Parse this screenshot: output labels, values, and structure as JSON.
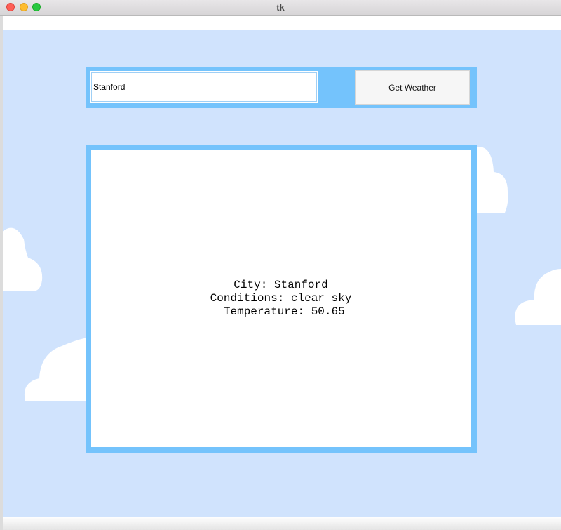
{
  "window": {
    "title": "tk"
  },
  "search": {
    "value": "Stanford",
    "button_label": "Get Weather"
  },
  "result": {
    "lines": [
      "City: Stanford",
      "Conditions: clear sky",
      " Temperature: 50.65"
    ]
  },
  "colors": {
    "sky": "#d0e3fd",
    "frame": "#74c3fc",
    "cloud": "#ffffff"
  }
}
